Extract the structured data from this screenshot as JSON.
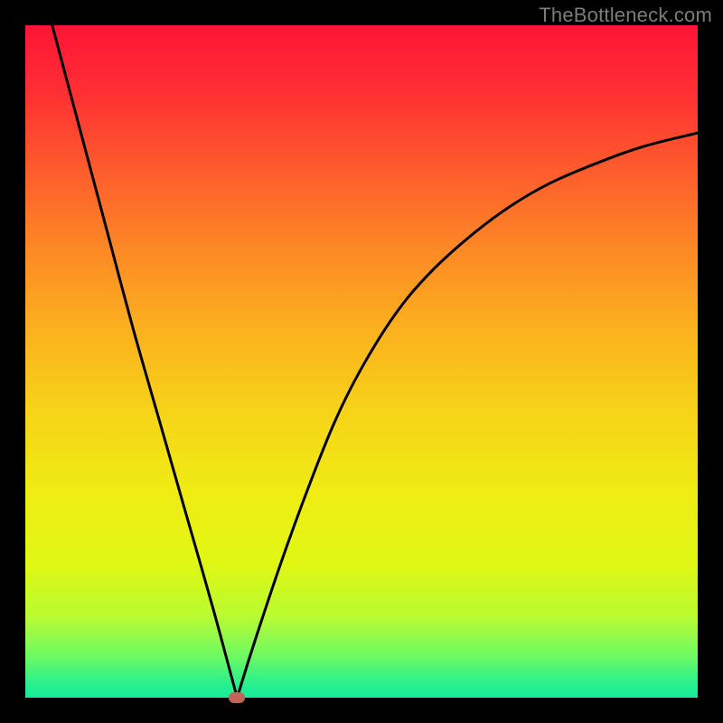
{
  "watermark": "TheBottleneck.com",
  "chart_data": {
    "type": "line",
    "title": "",
    "xlabel": "",
    "ylabel": "",
    "xlim": [
      0,
      100
    ],
    "ylim": [
      0,
      100
    ],
    "series": [
      {
        "name": "left-branch",
        "x": [
          4,
          8,
          12,
          16,
          20,
          24,
          28,
          31.5
        ],
        "values": [
          100,
          85,
          70,
          55,
          41,
          27,
          13,
          0
        ]
      },
      {
        "name": "right-branch",
        "x": [
          31.5,
          34,
          38,
          42,
          46,
          50,
          55,
          60,
          66,
          72,
          78,
          85,
          92,
          100
        ],
        "values": [
          0,
          8,
          20,
          31,
          41,
          49,
          57,
          63,
          68.5,
          73,
          76.5,
          79.5,
          82,
          84
        ]
      }
    ],
    "marker": {
      "x": 31.5,
      "y": 0,
      "color": "#c26559"
    },
    "background_gradient": {
      "stops": [
        {
          "pos": 0,
          "color": "#fd1537"
        },
        {
          "pos": 22,
          "color": "#fd5e2c"
        },
        {
          "pos": 46,
          "color": "#fbb31e"
        },
        {
          "pos": 70,
          "color": "#efed14"
        },
        {
          "pos": 88,
          "color": "#b8fb32"
        },
        {
          "pos": 100,
          "color": "#16eb9b"
        }
      ]
    }
  }
}
